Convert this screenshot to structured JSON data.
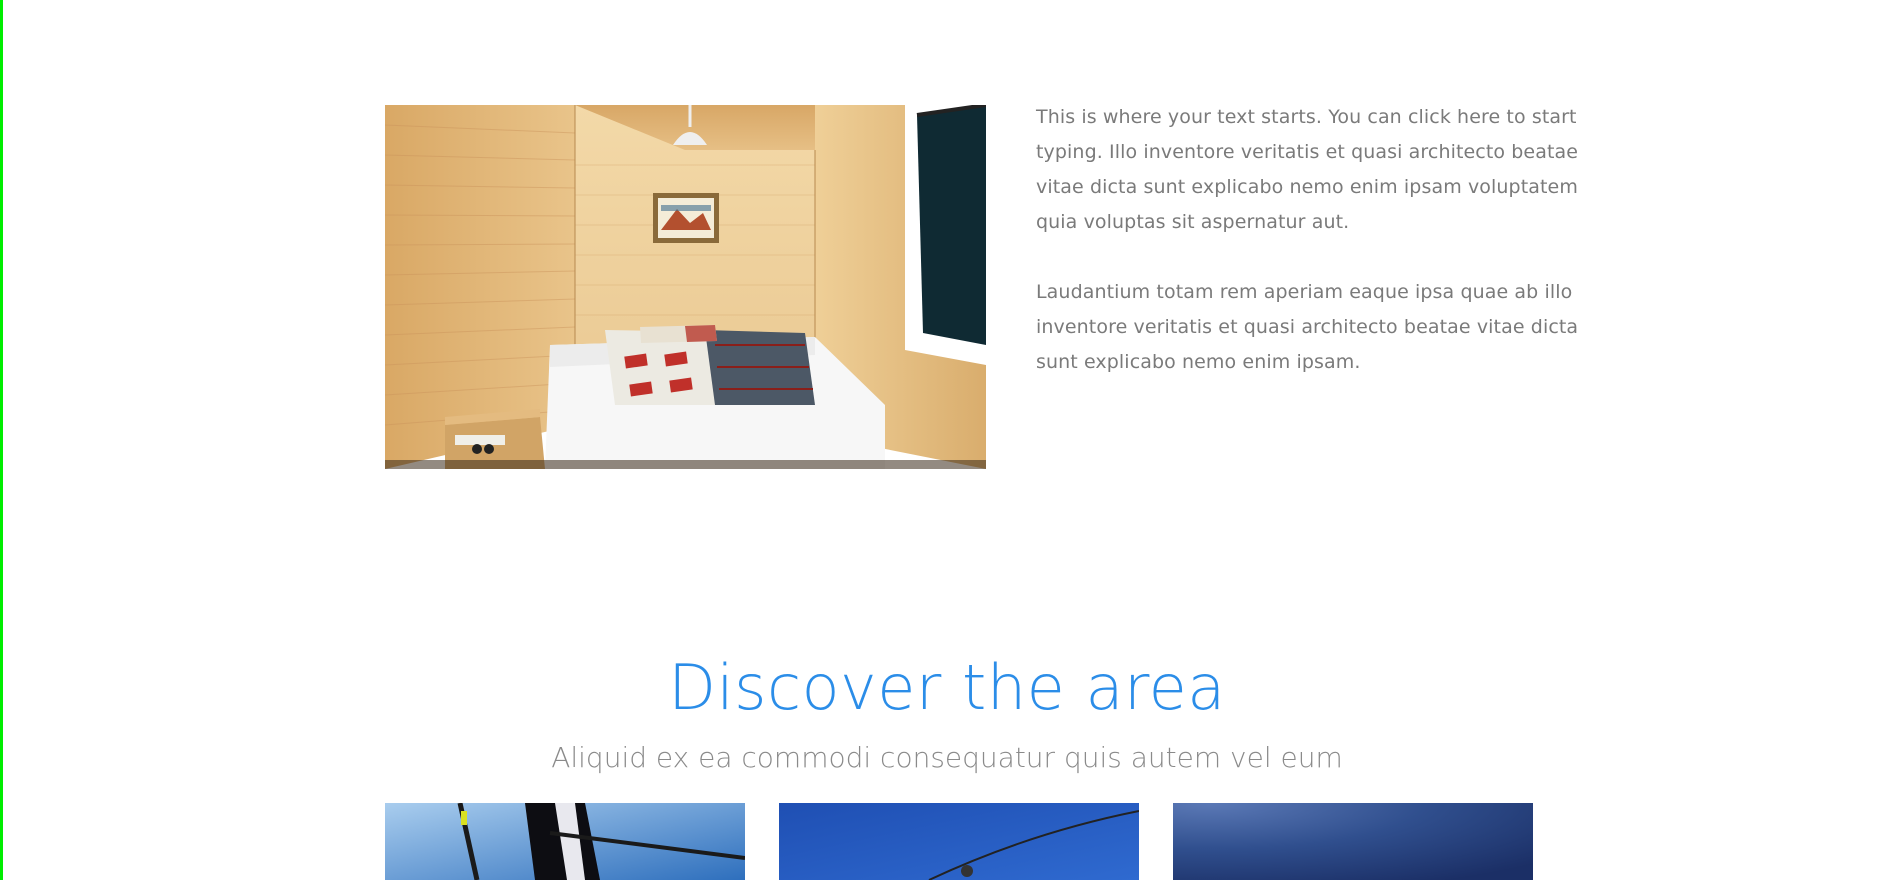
{
  "intro": {
    "paragraph_1": "This is where your text starts. You can click here to start typing. Illo inventore veritatis et quasi architecto beatae vitae dicta sunt explicabo nemo enim ipsam voluptatem quia voluptas sit aspernatur aut.",
    "paragraph_2": "Laudantium totam rem aperiam eaque ipsa quae ab illo inventore veritatis et quasi architecto beatae vitae dicta sunt explicabo nemo enim ipsam."
  },
  "discover": {
    "title": "Discover the area",
    "subtitle": "Aliquid ex ea commodi consequatur quis autem vel eum"
  },
  "colors": {
    "heading_blue": "#2b8de8",
    "body_text": "#7a7a7a",
    "subtitle_text": "#8a8a8a",
    "edge_bar": "#00ee00"
  }
}
